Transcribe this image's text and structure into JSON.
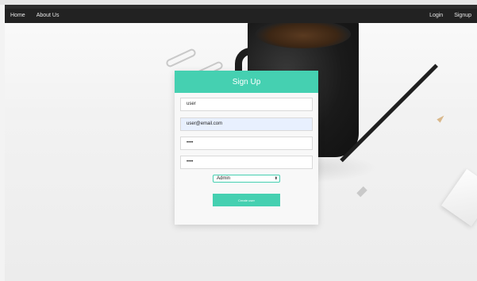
{
  "nav": {
    "left": [
      {
        "label": "Home"
      },
      {
        "label": "About Us"
      }
    ],
    "right": [
      {
        "label": "Login"
      },
      {
        "label": "Signup"
      }
    ]
  },
  "form": {
    "title": "Sign Up",
    "username_value": "user",
    "email_value": "user@email.com",
    "password_mask": "••••",
    "confirm_mask": "••••",
    "role_selected": "Admin",
    "submit_label": "Create user"
  },
  "colors": {
    "accent": "#45d0b1",
    "navbar": "#222222",
    "autofill": "#e8f0fe"
  }
}
